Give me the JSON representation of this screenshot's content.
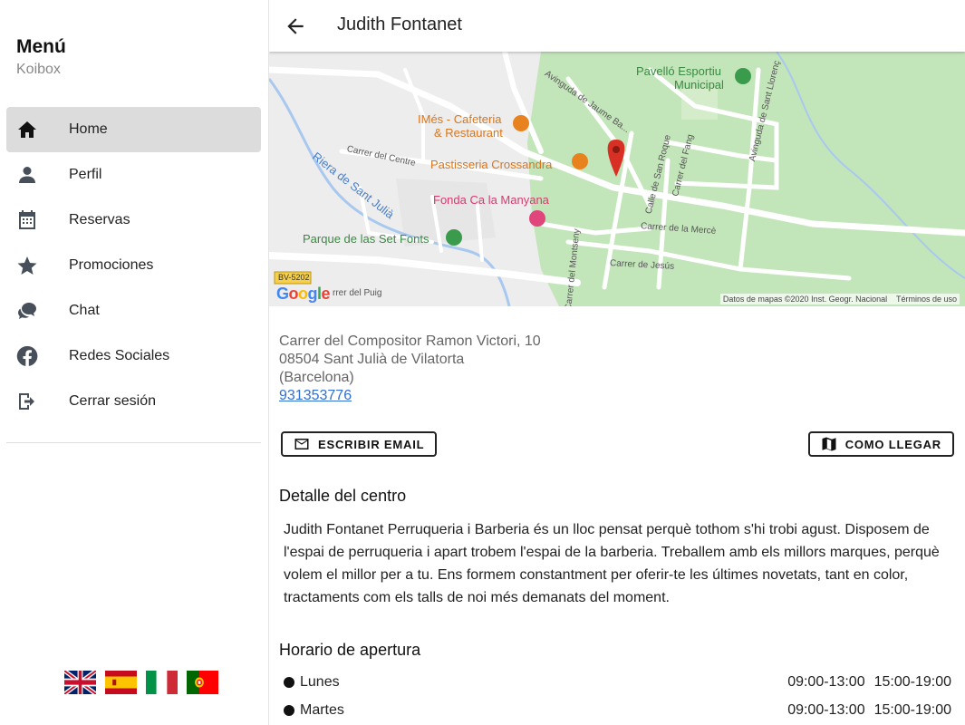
{
  "sidebar": {
    "title": "Menú",
    "subtitle": "Koibox",
    "items": [
      {
        "label": "Home",
        "icon": "home-icon",
        "active": true
      },
      {
        "label": "Perfil",
        "icon": "person-icon",
        "active": false
      },
      {
        "label": "Reservas",
        "icon": "calendar-icon",
        "active": false
      },
      {
        "label": "Promociones",
        "icon": "star-icon",
        "active": false
      },
      {
        "label": "Chat",
        "icon": "chat-icon",
        "active": false
      },
      {
        "label": "Redes Sociales",
        "icon": "facebook-icon",
        "active": false
      },
      {
        "label": "Cerrar sesión",
        "icon": "logout-icon",
        "active": false
      }
    ],
    "flags": [
      "uk-flag-icon",
      "spain-flag-icon",
      "italy-flag-icon",
      "portugal-flag-icon"
    ]
  },
  "header": {
    "title": "Judith Fontanet",
    "back_icon": "arrow-back-icon"
  },
  "map": {
    "labels": {
      "pavello": "Pavelló Esportiu",
      "municipal": "Municipal",
      "imes": "IMés - Cafeteria",
      "restaurant": "& Restaurant",
      "pastisseria": "Pastisseria Crossandra",
      "fonda": "Fonda Ca la Manyana",
      "parque": "Parque de las Set Fonts",
      "road_bv": "BV-5202",
      "carrer_centre": "Carrer del Centre",
      "riera": "Riera de Sant Julià",
      "carrer_merce": "Carrer de la Mercè",
      "carrer_jesus": "Carrer de Jesús",
      "carrer_puig": "rrer del Puig",
      "av_jaume": "Avinguda de Jaume Ba...",
      "av_llorenc": "Avinguda de Sant Llorenç",
      "calle_roque": "Calle de San Roque",
      "carrer_fang": "Carrer del Fang",
      "carrer_montseny": "Carrer del Montseny"
    },
    "google": "Google",
    "attribution": "Datos de mapas ©2020 Inst. Geogr. Nacional",
    "terms": "Términos de uso"
  },
  "address": {
    "line1": "Carrer del Compositor Ramon Victori, 10",
    "line2": "08504 Sant Julià de Vilatorta",
    "line3": "(Barcelona)",
    "phone": "931353776"
  },
  "buttons": {
    "email": "ESCRIBIR EMAIL",
    "route": "COMO LLEGAR"
  },
  "detail": {
    "title": "Detalle del centro",
    "text": "Judith Fontanet Perruqueria i Barberia és un lloc pensat perquè tothom s'hi trobi agust. Disposem de l'espai de perruqueria i apart trobem l'espai de la barberia. Treballem amb els millors marques, perquè volem el millor per a tu. Ens formem constantment per oferir-te les últimes novetats, tant en color, tractaments com els talls de noi més demanats del moment."
  },
  "hours": {
    "title": "Horario de apertura",
    "rows": [
      {
        "day": "Lunes",
        "morning": "09:00-13:00",
        "afternoon": "15:00-19:00"
      },
      {
        "day": "Martes",
        "morning": "09:00-13:00",
        "afternoon": "15:00-19:00"
      }
    ]
  },
  "colors": {
    "accent_link": "#2f6fd6",
    "map_pin": "#d93025",
    "map_park": "#c2e4b8",
    "map_poi_orange": "#e8821e",
    "map_poi_pink": "#e0457b",
    "map_poi_green": "#3a9b4c"
  }
}
